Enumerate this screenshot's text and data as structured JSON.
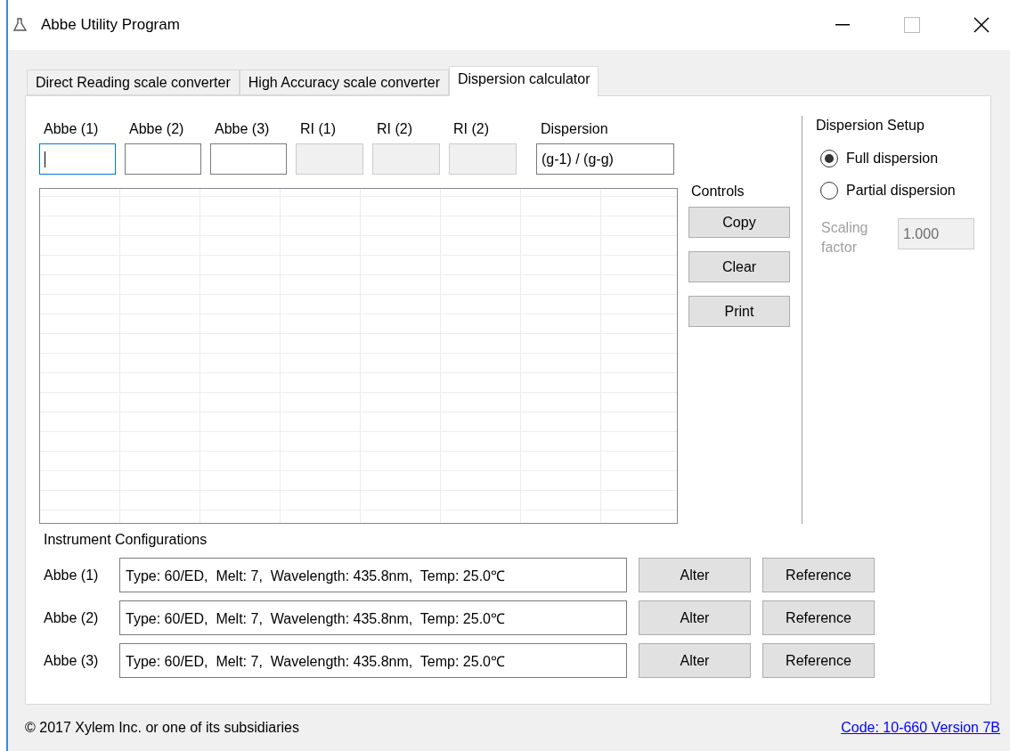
{
  "window": {
    "title": "Abbe Utility Program"
  },
  "tabs": [
    {
      "label": "Direct Reading scale converter",
      "selected": false
    },
    {
      "label": "High Accuracy scale converter",
      "selected": false
    },
    {
      "label": "Dispersion calculator",
      "selected": true
    }
  ],
  "inputs": [
    {
      "label": "Abbe (1)",
      "disabled": false,
      "focused": true
    },
    {
      "label": "Abbe (2)",
      "disabled": false,
      "focused": false
    },
    {
      "label": "Abbe (3)",
      "disabled": false,
      "focused": false
    },
    {
      "label": "RI (1)",
      "disabled": true,
      "focused": false
    },
    {
      "label": "RI (2)",
      "disabled": true,
      "focused": false
    },
    {
      "label": "RI (2)",
      "disabled": true,
      "focused": false
    }
  ],
  "dispersion": {
    "label": "Dispersion",
    "value": "(g-1) / (g-g)"
  },
  "controls": {
    "label": "Controls",
    "buttons": [
      "Copy",
      "Clear",
      "Print"
    ]
  },
  "setup": {
    "title": "Dispersion Setup",
    "options": [
      {
        "label": "Full dispersion",
        "selected": true
      },
      {
        "label": "Partial dispersion",
        "selected": false
      }
    ],
    "scaling": {
      "label": "Scaling factor",
      "value": "1.000",
      "disabled": true
    }
  },
  "instruments": {
    "title": "Instrument Configurations",
    "rows": [
      {
        "label": "Abbe (1)",
        "value": "Type: 60/ED,  Melt: 7,  Wavelength: 435.8nm,  Temp: 25.0℃",
        "buttons": [
          "Alter",
          "Reference"
        ]
      },
      {
        "label": "Abbe (2)",
        "value": "Type: 60/ED,  Melt: 7,  Wavelength: 435.8nm,  Temp: 25.0℃",
        "buttons": [
          "Alter",
          "Reference"
        ]
      },
      {
        "label": "Abbe (3)",
        "value": "Type: 60/ED,  Melt: 7,  Wavelength: 435.8nm,  Temp: 25.0℃",
        "buttons": [
          "Alter",
          "Reference"
        ]
      }
    ]
  },
  "footer": {
    "copyright": "© 2017 Xylem Inc. or one of its subsidiaries",
    "link": "Code: 10-660 Version 7B"
  }
}
